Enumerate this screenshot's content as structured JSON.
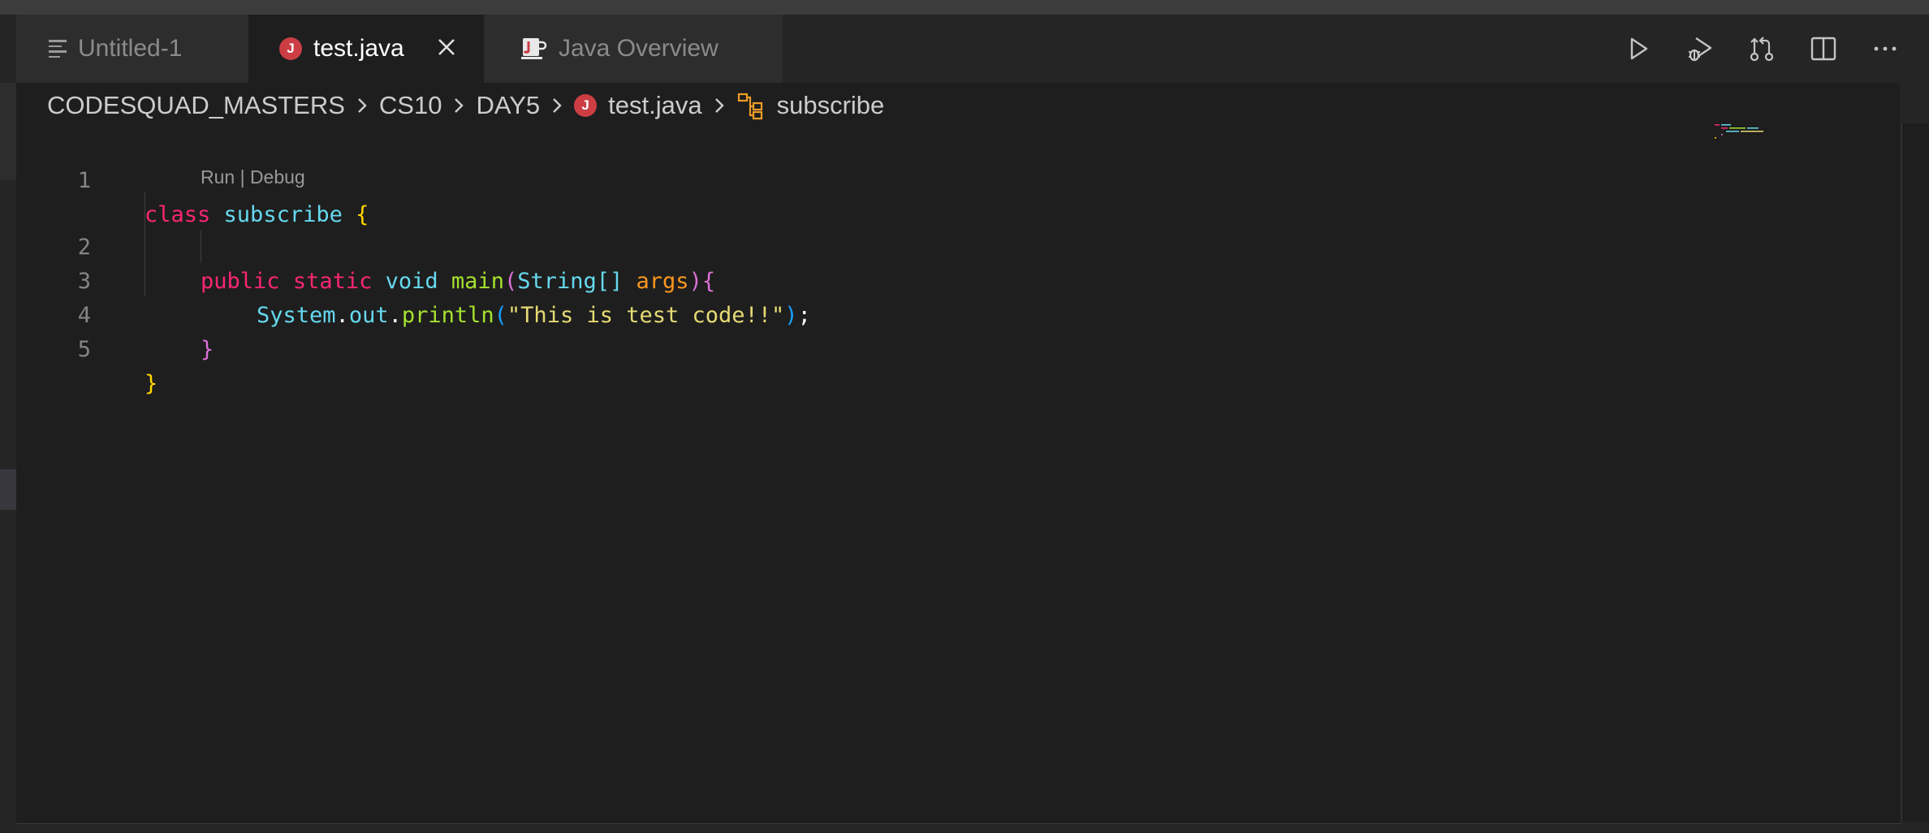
{
  "tabs": [
    {
      "label": "Untitled-1",
      "icon": "text-lines-icon",
      "active": false
    },
    {
      "label": "test.java",
      "icon": "java-file-icon",
      "active": true
    },
    {
      "label": "Java Overview",
      "icon": "java-coffee-icon",
      "active": false
    }
  ],
  "tab_close_icon": "close-icon",
  "editor_actions": [
    {
      "name": "run-icon"
    },
    {
      "name": "debug-icon"
    },
    {
      "name": "source-control-compare-icon"
    },
    {
      "name": "split-editor-icon"
    },
    {
      "name": "more-actions-icon"
    }
  ],
  "breadcrumb": {
    "items": [
      "CODESQUAD_MASTERS",
      "CS10",
      "DAY5",
      "test.java",
      "subscribe"
    ]
  },
  "code_lens": "Run | Debug",
  "code": {
    "line_numbers": [
      "1",
      "2",
      "3",
      "4",
      "5"
    ],
    "l1": {
      "kw": "class",
      "name": "subscribe",
      "brace": "{"
    },
    "l2": {
      "kw1": "public",
      "kw2": "static",
      "type": "void",
      "fn": "main",
      "open": "(",
      "ptype": "String[]",
      "param": "args",
      "close": ")",
      "brace": "{"
    },
    "l3": {
      "obj": "System",
      "dot1": ".",
      "field": "out",
      "dot2": ".",
      "fn": "println",
      "open": "(",
      "str": "\"This is test code!!\"",
      "close": ")",
      "semi": ";"
    },
    "l4": {
      "brace": "}"
    },
    "l5": {
      "brace": "}"
    }
  },
  "colors": {
    "editor_bg": "#1e1e1e",
    "tab_active_bg": "#1e1e1e",
    "tab_inactive_bg": "#2d2d2d",
    "java_icon": "#cc3e44",
    "class_symbol": "#ee9d28"
  }
}
